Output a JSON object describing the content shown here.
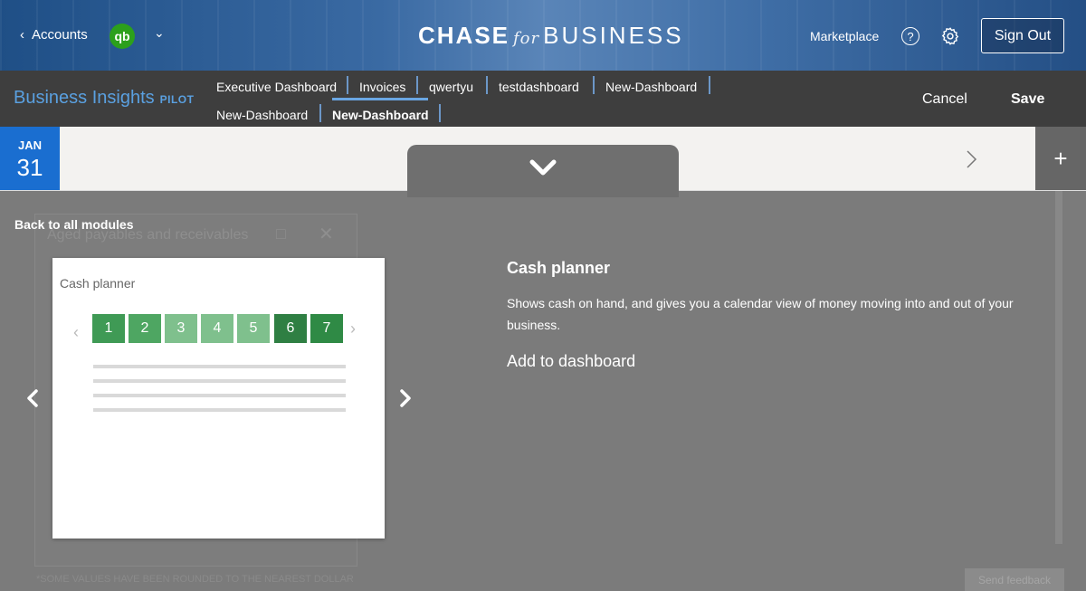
{
  "header": {
    "accounts_label": "Accounts",
    "qb_logo": "qb",
    "brand_chase": "CHASE",
    "brand_for": "for",
    "brand_business": "BUSINESS",
    "marketplace": "Marketplace",
    "help_glyph": "?",
    "sign_out": "Sign Out"
  },
  "subheader": {
    "title": "Business Insights",
    "badge": "PILOT",
    "tabs": [
      {
        "label": "Executive Dashboard"
      },
      {
        "label": "Invoices"
      },
      {
        "label": "qwertyu"
      },
      {
        "label": "testdashboard"
      },
      {
        "label": "New-Dashboard"
      },
      {
        "label": "New-Dashboard"
      },
      {
        "label": "New-Dashboard"
      }
    ],
    "cancel": "Cancel",
    "save": "Save"
  },
  "datebar": {
    "month": "JAN",
    "day": "31",
    "plus": "+"
  },
  "background_card": {
    "title": "Aged payables and receivables",
    "footnote": "*SOME VALUES HAVE BEEN ROUNDED TO THE NEAREST DOLLAR",
    "feedback": "Send feedback"
  },
  "module_picker": {
    "back_label": "Back to all modules",
    "preview_title": "Cash planner",
    "days": [
      {
        "label": "1",
        "color": "#3f9a55"
      },
      {
        "label": "2",
        "color": "#4ea662"
      },
      {
        "label": "3",
        "color": "#7fc08d"
      },
      {
        "label": "4",
        "color": "#7fc08d"
      },
      {
        "label": "5",
        "color": "#7fc08d"
      },
      {
        "label": "6",
        "color": "#2f7f43"
      },
      {
        "label": "7",
        "color": "#2f8a45"
      }
    ],
    "detail_title": "Cash planner",
    "detail_description": "Shows cash on hand, and gives you a calendar view of money moving into and out of your business.",
    "add_label": "Add to dashboard"
  },
  "colors": {
    "accent": "#1a6ed0",
    "tab_underline": "#6aa6e3",
    "brand_green": "#2ca01c"
  }
}
